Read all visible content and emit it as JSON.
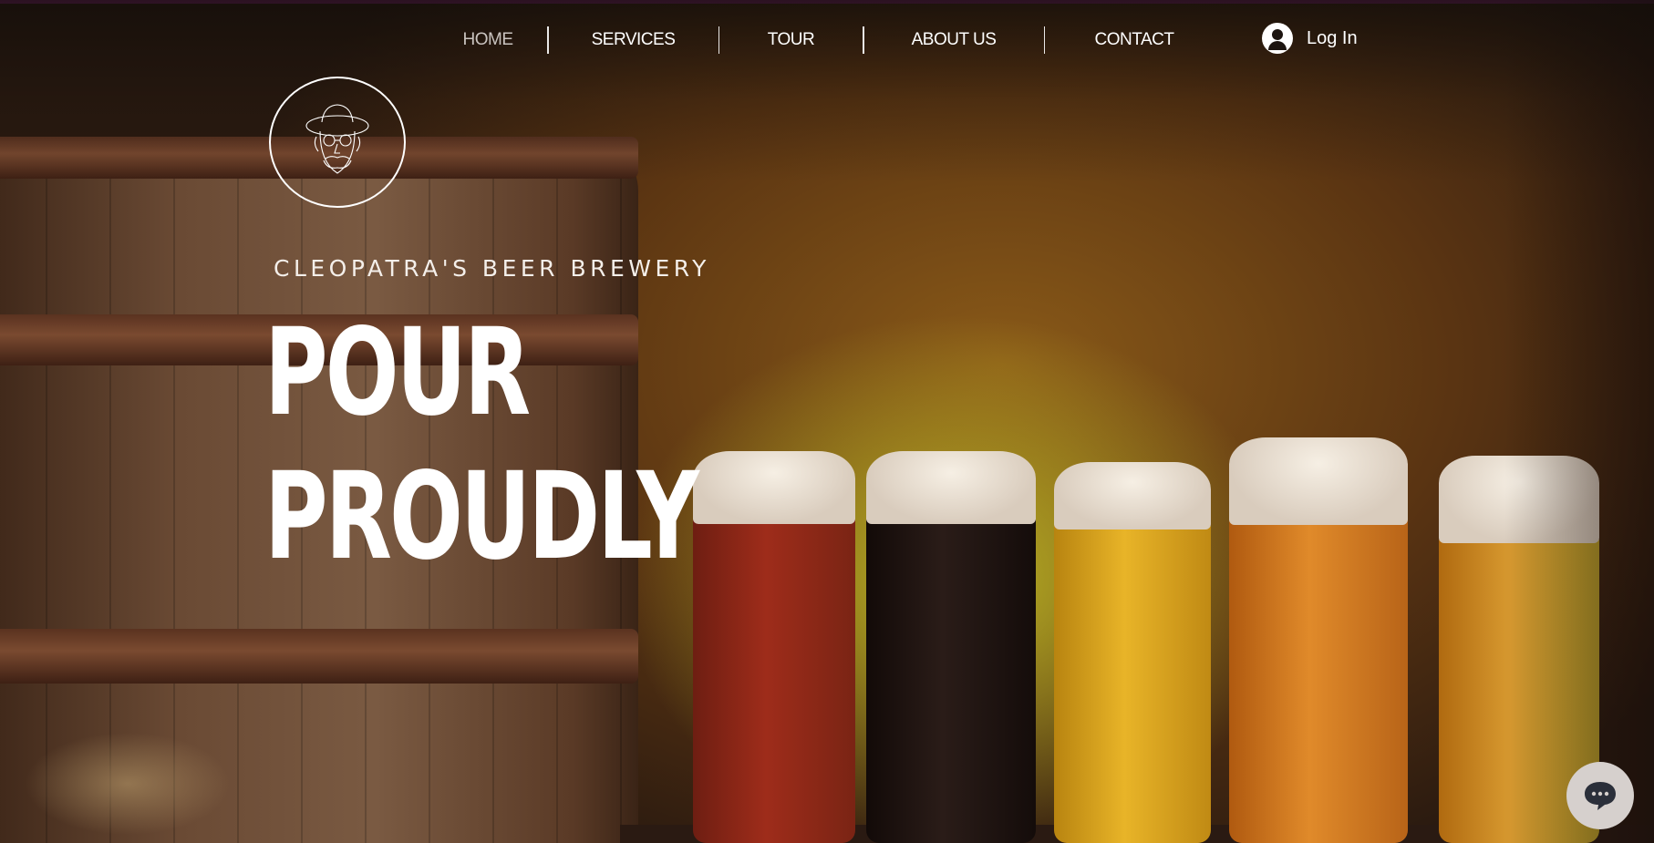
{
  "nav": {
    "items": [
      {
        "label": "HOME",
        "active": true
      },
      {
        "label": "SERVICES",
        "active": false
      },
      {
        "label": "TOUR",
        "active": false
      },
      {
        "label": "ABOUT US",
        "active": false
      },
      {
        "label": "CONTACT",
        "active": false
      }
    ],
    "login_label": "Log In",
    "login_icon": "user-avatar-icon"
  },
  "hero": {
    "logo_icon": "bearded-man-hat-logo-icon",
    "subtitle": "CLEOPATRA'S BEER BREWERY",
    "headline_line1": "POUR",
    "headline_line2": "PROUDLY"
  },
  "chat": {
    "icon": "chat-bubble-icon"
  },
  "colors": {
    "top_accent": "#b02aa8",
    "text": "#ffffff",
    "nav_active": "#c9c3bf",
    "chat_button": "#d6d0cd"
  }
}
